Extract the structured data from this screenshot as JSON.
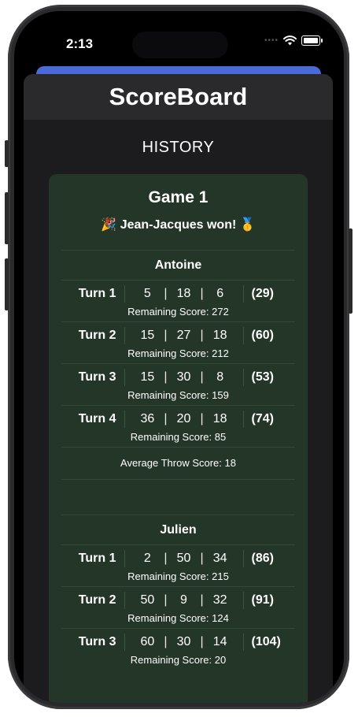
{
  "status_bar": {
    "time": "2:13"
  },
  "app": {
    "title": "ScoreBoard",
    "section_title": "HISTORY"
  },
  "games": [
    {
      "title": "Game 1",
      "winner_text": "🎉 Jean-Jacques won! 🥇",
      "players": [
        {
          "name": "Antoine",
          "turns": [
            {
              "label": "Turn 1",
              "throws": [
                "5",
                "18",
                "6"
              ],
              "total": "(29)",
              "remaining": "Remaining Score: 272"
            },
            {
              "label": "Turn 2",
              "throws": [
                "15",
                "27",
                "18"
              ],
              "total": "(60)",
              "remaining": "Remaining Score: 212"
            },
            {
              "label": "Turn 3",
              "throws": [
                "15",
                "30",
                "8"
              ],
              "total": "(53)",
              "remaining": "Remaining Score: 159"
            },
            {
              "label": "Turn 4",
              "throws": [
                "36",
                "20",
                "18"
              ],
              "total": "(74)",
              "remaining": "Remaining Score: 85"
            }
          ],
          "average": "Average Throw Score: 18"
        },
        {
          "name": "Julien",
          "turns": [
            {
              "label": "Turn 1",
              "throws": [
                "2",
                "50",
                "34"
              ],
              "total": "(86)",
              "remaining": "Remaining Score: 215"
            },
            {
              "label": "Turn 2",
              "throws": [
                "50",
                "9",
                "32"
              ],
              "total": "(91)",
              "remaining": "Remaining Score: 124"
            },
            {
              "label": "Turn 3",
              "throws": [
                "60",
                "30",
                "14"
              ],
              "total": "(104)",
              "remaining": "Remaining Score: 20"
            }
          ],
          "average": ""
        }
      ]
    }
  ],
  "colors": {
    "card_bg": "#243627",
    "accent_sheet": "#4a6ad8",
    "nav_bg": "#2a2a2c"
  }
}
